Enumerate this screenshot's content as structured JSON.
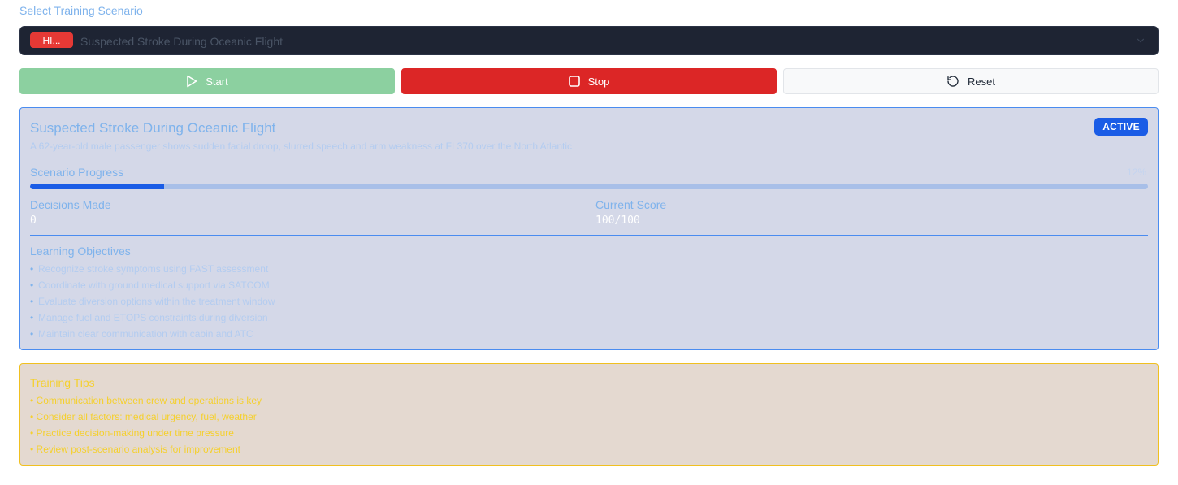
{
  "selector": {
    "label": "Select Training Scenario",
    "severity_badge": "HI...",
    "selected_value": "Suspected Stroke During Oceanic Flight"
  },
  "controls": {
    "start_label": "Start",
    "stop_label": "Stop",
    "reset_label": "Reset"
  },
  "scenario": {
    "title": "Suspected Stroke During Oceanic Flight",
    "status": "ACTIVE",
    "description": "A 62-year-old male passenger shows sudden facial droop, slurred speech and arm weakness at FL370 over the North Atlantic",
    "progress_label": "Scenario Progress",
    "progress_text": "12%",
    "progress_fraction": 0.12,
    "decisions_label": "Decisions Made",
    "decisions_value": "0",
    "score_label": "Current Score",
    "score_value": "100/100",
    "objectives_title": "Learning Objectives",
    "objectives": [
      "Recognize stroke symptoms using FAST assessment",
      "Coordinate with ground medical support via SATCOM",
      "Evaluate diversion options within the treatment window",
      "Manage fuel and ETOPS constraints during diversion",
      "Maintain clear communication with cabin and ATC"
    ]
  },
  "tips": {
    "title": "Training Tips",
    "items": [
      "• Communication between crew and operations is key",
      "• Consider all factors: medical urgency, fuel, weather",
      "• Practice decision-making under time pressure",
      "• Review post-scenario analysis for improvement"
    ]
  },
  "colors": {
    "accent": "#1a5ce6",
    "danger": "#dc2626",
    "success_muted": "#8cd0a0",
    "warning": "#f0c020"
  },
  "icons": {
    "start": "play-icon",
    "stop": "stop-icon",
    "reset": "rotate-ccw-icon",
    "dropdown": "chevron-down-icon"
  }
}
